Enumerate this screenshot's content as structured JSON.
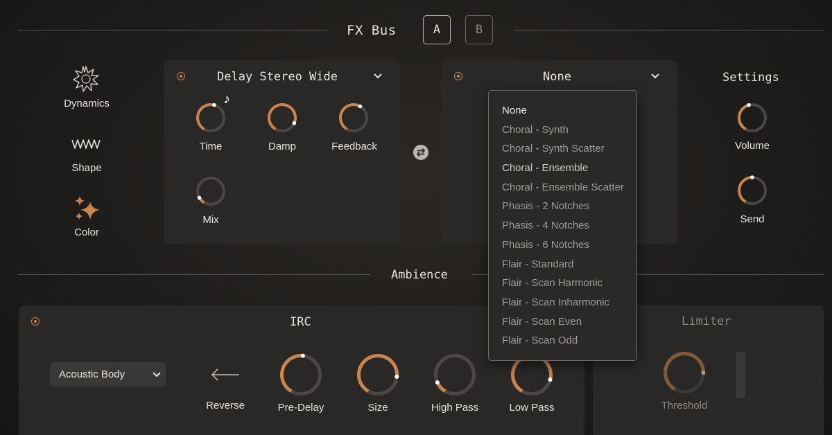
{
  "header": {
    "title": "FX Bus",
    "buttons": [
      "A",
      "B"
    ]
  },
  "sidebar": {
    "items": [
      {
        "label": "Dynamics",
        "icon": "burst-icon"
      },
      {
        "label": "Shape",
        "icon": "wave-icon"
      },
      {
        "label": "Color",
        "icon": "sparkle-icon"
      }
    ]
  },
  "fx1": {
    "title": "Delay Stereo Wide",
    "knobs": [
      {
        "label": "Time",
        "value": 0.55
      },
      {
        "label": "Damp",
        "value": 0.88
      },
      {
        "label": "Feedback",
        "value": 0.6
      },
      {
        "label": "Mix",
        "value": 0.1
      }
    ]
  },
  "fx2": {
    "title": "None",
    "dropdown_options": [
      "None",
      "Choral - Synth",
      "Choral - Synth Scatter",
      "Choral - Ensemble",
      "Choral - Ensemble Scatter",
      "Phasis - 2 Notches",
      "Phasis - 4 Notches",
      "Phasis - 6 Notches",
      "Flair - Standard",
      "Flair - Scan Harmonic",
      "Flair - Scan Inharmonic",
      "Flair - Scan Even",
      "Flair - Scan Odd"
    ]
  },
  "settings": {
    "title": "Settings",
    "knobs": [
      {
        "label": "Volume",
        "value": 0.45
      },
      {
        "label": "Send",
        "value": 0.5
      }
    ]
  },
  "ambience": {
    "title": "Ambience",
    "irc": {
      "title": "IRC",
      "preset": "Acoustic Body",
      "reverse_label": "Reverse",
      "knobs": [
        {
          "label": "Pre-Delay",
          "value": 0.52
        },
        {
          "label": "Size",
          "value": 0.82
        },
        {
          "label": "High Pass",
          "value": 0.12
        },
        {
          "label": "Low Pass",
          "value": 0.85
        }
      ]
    },
    "limiter": {
      "title": "Limiter",
      "knob_label": "Threshold",
      "value": 0.8
    }
  },
  "colors": {
    "accent": "#c9844d",
    "track": "#4a4744",
    "background": "#1f1d1b"
  }
}
